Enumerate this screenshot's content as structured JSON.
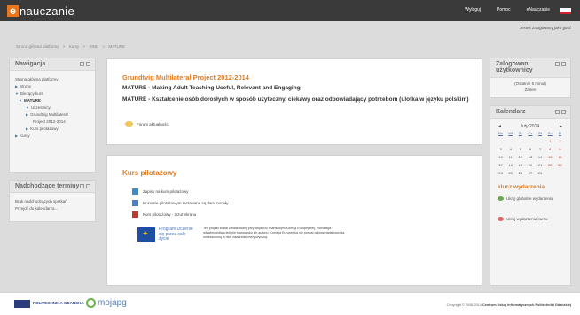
{
  "header": {
    "logo_letter": "e",
    "logo_text": "nauczanie",
    "links": [
      "Wyloguj",
      "Pomoc",
      "eNauczanie"
    ]
  },
  "user_status": "Jesteś zalogowany jako gość",
  "breadcrumb": [
    "Strona główna platformy",
    ">",
    "Kursy",
    ">",
    "INNE",
    ">",
    "MATURE"
  ],
  "navigation": {
    "title": "Nawigacja",
    "items": [
      {
        "label": "Strona główna platformy",
        "level": 1,
        "arrow": ""
      },
      {
        "label": "Strony",
        "level": 1,
        "arrow": "▶"
      },
      {
        "label": "Bieżący kurs",
        "level": 1,
        "arrow": "▼"
      },
      {
        "label": "MATURE",
        "level": 2,
        "arrow": "▼"
      },
      {
        "label": "Uczestnicy",
        "level": 3,
        "arrow": "▼"
      },
      {
        "label": "Grundtvig Multilateral",
        "level": 3,
        "arrow": "▶"
      },
      {
        "label": "Project 2012-2014",
        "level": 4,
        "arrow": ""
      },
      {
        "label": "Kurs pilotażowy",
        "level": 3,
        "arrow": "▶"
      },
      {
        "label": "Kursy",
        "level": 1,
        "arrow": "▶"
      }
    ]
  },
  "upcoming": {
    "title": "Nadchodzące terminy",
    "empty": "Brak nadchodzących spotkań",
    "link": "Przejdź do kalendarza..."
  },
  "section1": {
    "title": "Grundtvig Multilateral Project 2012-2014",
    "subtitle": "MATURE - Making Adult Teaching Useful, Relevant and Engaging",
    "description": "MATURE - Kształcenie osób dorosłych w sposób użyteczny, ciekawy oraz odpowiadający potrzebom (ulotka w języku polskim)",
    "forum": "Forum aktualności"
  },
  "section2": {
    "title": "Kurs pilotażowy",
    "resources": [
      "Zapisy na kurs pilotażowy",
      "W kursie pilotażowym testowane są dwa moduły",
      "Kurs pilotażowy - zrzut ekranu"
    ],
    "eu_text": "Program Uczenie się przez całe życie",
    "eu_desc": "Ten projekt został zrealizowany przy wsparciu finansowym Komisji Europejskiej. Publikacja odzwierciedlają jedynie stanowisko ich autora i Komisja Europejska nie ponosi odpowiedzialności za umieszczoną w nich zawartość merytoryczną."
  },
  "login_panel": {
    "title": "Zalogowani użytkownicy",
    "period": "(Ostatnie 5 minut)",
    "none": "Żaden"
  },
  "calendar": {
    "title": "Kalendarz",
    "month": "luty 2014",
    "prev": "◄",
    "next": "►",
    "weekdays": [
      "Pn",
      "Wt",
      "Śr",
      "Cz",
      "Pt",
      "So",
      "N"
    ],
    "days": [
      "",
      "",
      "",
      "",
      "",
      "1",
      "2",
      "3",
      "4",
      "5",
      "6",
      "7",
      "8",
      "9",
      "10",
      "11",
      "12",
      "13",
      "14",
      "15",
      "16",
      "17",
      "18",
      "19",
      "20",
      "21",
      "22",
      "23",
      "24",
      "25",
      "26",
      "27",
      "28",
      "",
      ""
    ]
  },
  "key": {
    "title": "klucz wydarzenia",
    "items": [
      "Ukryj globalne wydarzenia",
      "Ukryj wydarzenia kursu"
    ],
    "colors": [
      "#6aa84f",
      "#e06666"
    ]
  },
  "footer": {
    "pg_name": "POLITECHNIKA GDAŃSKA",
    "moj": "mojapg",
    "copyright_prefix": "Copyright © 2008-2014",
    "copyright_org": "Centrum Usług Informatycznych Politechniki Gdańskiej"
  },
  "colors": {
    "accent": "#e07b20",
    "topbar": "#3a3a3a"
  }
}
